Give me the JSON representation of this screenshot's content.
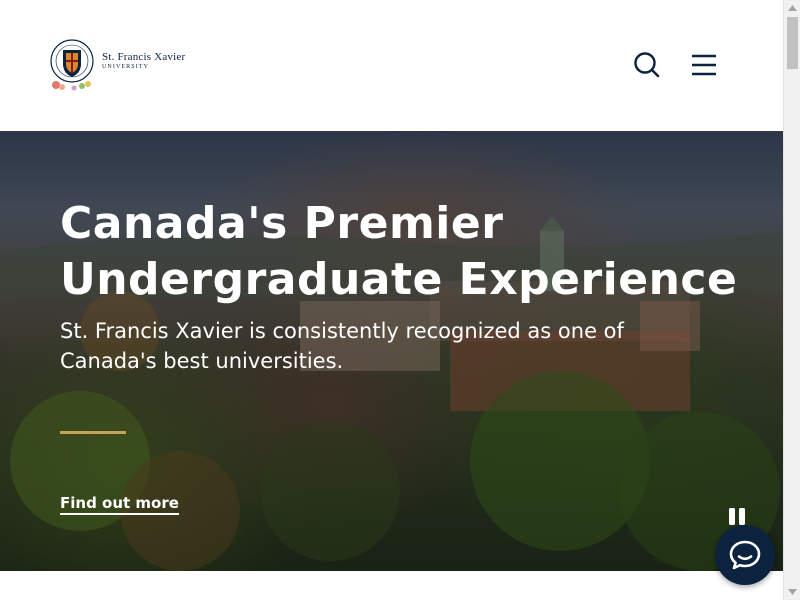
{
  "header": {
    "logo": {
      "name_line1": "St. Francis Xavier",
      "name_line2": "UNIVERSITY"
    },
    "search_icon": "search-icon",
    "menu_icon": "hamburger-menu-icon"
  },
  "hero": {
    "title": "Canada's Premier Undergraduate Experience",
    "subtitle": "St. Francis Xavier is consistently recognized as one of Canada's best universities.",
    "cta_label": "Find out more",
    "pause_icon": "pause-icon"
  },
  "chat": {
    "icon": "chat-bubble-icon"
  },
  "colors": {
    "navy": "#0c2340",
    "gold_accent": "#c8a158",
    "white": "#ffffff"
  }
}
